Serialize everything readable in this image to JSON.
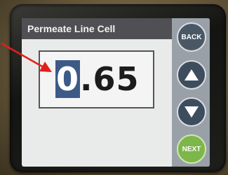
{
  "screen": {
    "title": "Permeate Line Cell"
  },
  "value_display": {
    "selected_digit": "0",
    "remaining": ".65"
  },
  "buttons": {
    "back_label": "BACK",
    "up_icon": "triangle-up",
    "down_icon": "triangle-down",
    "next_label": "NEXT"
  },
  "colors": {
    "title_bar": "#4f4f54",
    "cursor_highlight": "#3d5a86",
    "next_button": "#7db64a",
    "annotation_arrow": "#e0201b"
  }
}
